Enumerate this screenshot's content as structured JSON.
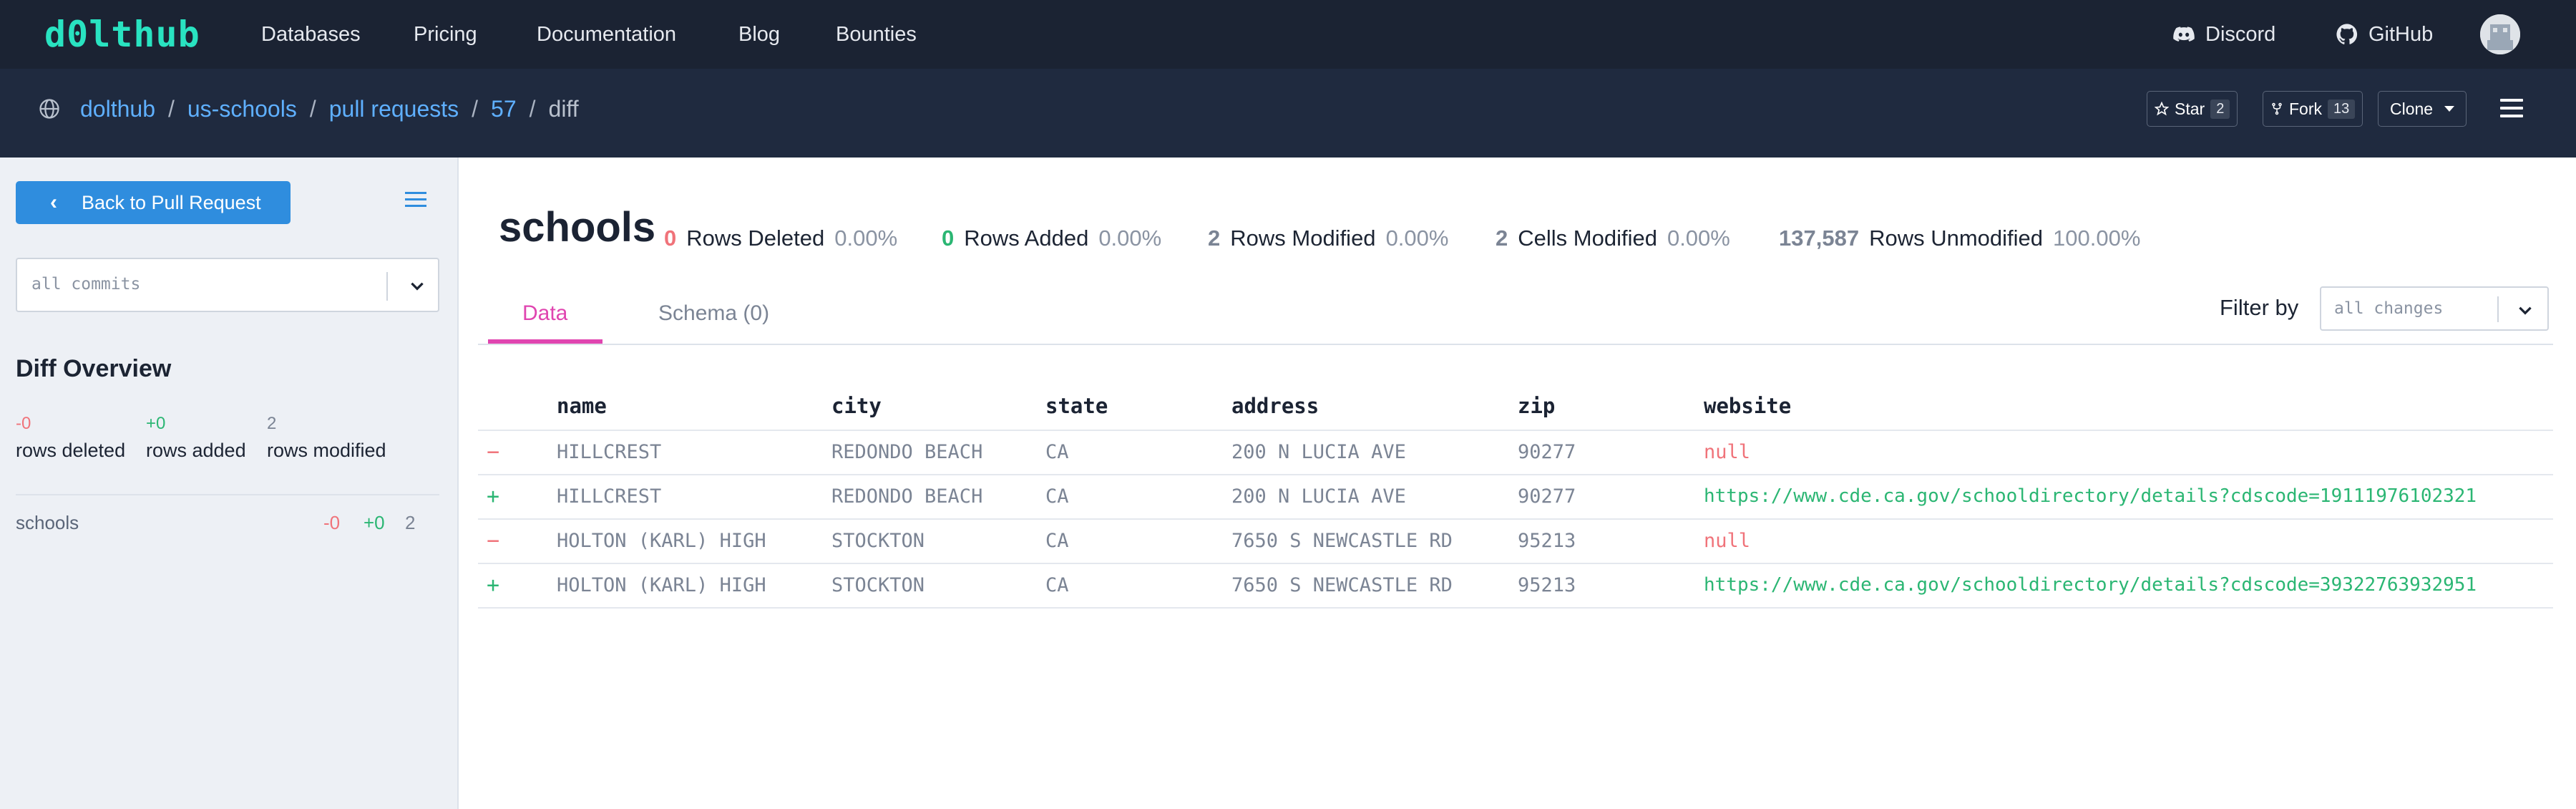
{
  "nav": {
    "logo": "d0lthub",
    "links": [
      "Databases",
      "Pricing",
      "Documentation",
      "Blog",
      "Bounties"
    ],
    "discord": "Discord",
    "github": "GitHub"
  },
  "breadcrumb": {
    "owner": "dolthub",
    "repo": "us-schools",
    "section": "pull requests",
    "number": "57",
    "current": "diff",
    "sep": "/"
  },
  "repo_actions": {
    "star_label": "Star",
    "star_count": "2",
    "fork_label": "Fork",
    "fork_count": "13",
    "clone_label": "Clone"
  },
  "sidebar": {
    "back_label": "Back to Pull Request",
    "commit_placeholder": "all commits",
    "overview_title": "Diff Overview",
    "overview": [
      {
        "value": "-0",
        "label": "rows deleted",
        "color": "#f0737a"
      },
      {
        "value": "+0",
        "label": "rows added",
        "color": "#2bb673"
      },
      {
        "value": "2",
        "label": "rows modified",
        "color": "#7b8494"
      }
    ],
    "tables": [
      {
        "name": "schools",
        "deleted": "-0",
        "added": "+0",
        "modified": "2"
      }
    ]
  },
  "main": {
    "table_name": "schools",
    "stats": [
      {
        "num": "0",
        "label": "Rows Deleted",
        "pct": "0.00%",
        "color": "#f0737a"
      },
      {
        "num": "0",
        "label": "Rows Added",
        "pct": "0.00%",
        "color": "#2bb673"
      },
      {
        "num": "2",
        "label": "Rows Modified",
        "pct": "0.00%",
        "color": "#7b8494"
      },
      {
        "num": "2",
        "label": "Cells Modified",
        "pct": "0.00%",
        "color": "#7b8494"
      },
      {
        "num": "137,587",
        "label": "Rows Unmodified",
        "pct": "100.00%",
        "color": "#7b8494"
      }
    ],
    "tabs": [
      {
        "label": "Data",
        "active": true
      },
      {
        "label": "Schema (0)",
        "active": false
      }
    ],
    "filter_label": "Filter by",
    "filter_placeholder": "all changes",
    "columns": [
      "name",
      "city",
      "state",
      "address",
      "zip",
      "website"
    ],
    "rows": [
      {
        "marker": "−",
        "type": "removed",
        "cells": [
          "HILLCREST",
          "REDONDO BEACH",
          "CA",
          "200 N LUCIA AVE",
          "90277",
          "null"
        ]
      },
      {
        "marker": "+",
        "type": "added",
        "cells": [
          "HILLCREST",
          "REDONDO BEACH",
          "CA",
          "200 N LUCIA AVE",
          "90277",
          "https://www.cde.ca.gov/schooldirectory/details?cdscode=19111976102321"
        ]
      },
      {
        "marker": "−",
        "type": "removed",
        "cells": [
          "HOLTON (KARL) HIGH",
          "STOCKTON",
          "CA",
          "7650 S NEWCASTLE RD",
          "95213",
          "null"
        ]
      },
      {
        "marker": "+",
        "type": "added",
        "cells": [
          "HOLTON (KARL) HIGH",
          "STOCKTON",
          "CA",
          "7650 S NEWCASTLE RD",
          "95213",
          "https://www.cde.ca.gov/schooldirectory/details?cdscode=39322763932951"
        ]
      }
    ]
  },
  "colors": {
    "accent": "#2f8dde",
    "removed": "#f0737a",
    "added": "#2bb673",
    "tab_active": "#e045b0",
    "nav_bg": "#1b2333"
  }
}
